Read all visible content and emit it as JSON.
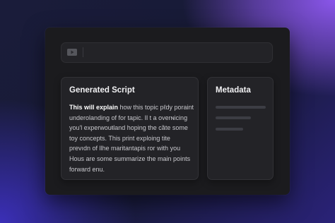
{
  "toolbar": {
    "icon": "video-icon"
  },
  "script_panel": {
    "title": "Generated Script",
    "lead": "This will explain",
    "first_line_rest": " how this topic pℓdy poraint",
    "lines": [
      "underolanding of for tapic. Il t a overɴicing",
      "you'l experwouŧland hoping the cȁte some",
      "toy concepts. This print exploing tite",
      "prevıdn of llhe maritantapis ror with you",
      "Hous are some summarize the main points",
      "forward enu."
    ]
  },
  "metadata_panel": {
    "title": "Metadata"
  },
  "colors": {
    "accent_purple": "#8a56ea",
    "accent_blue": "#3b2fb8",
    "window_bg": "#1b1b1e",
    "panel_bg": "#232327"
  }
}
